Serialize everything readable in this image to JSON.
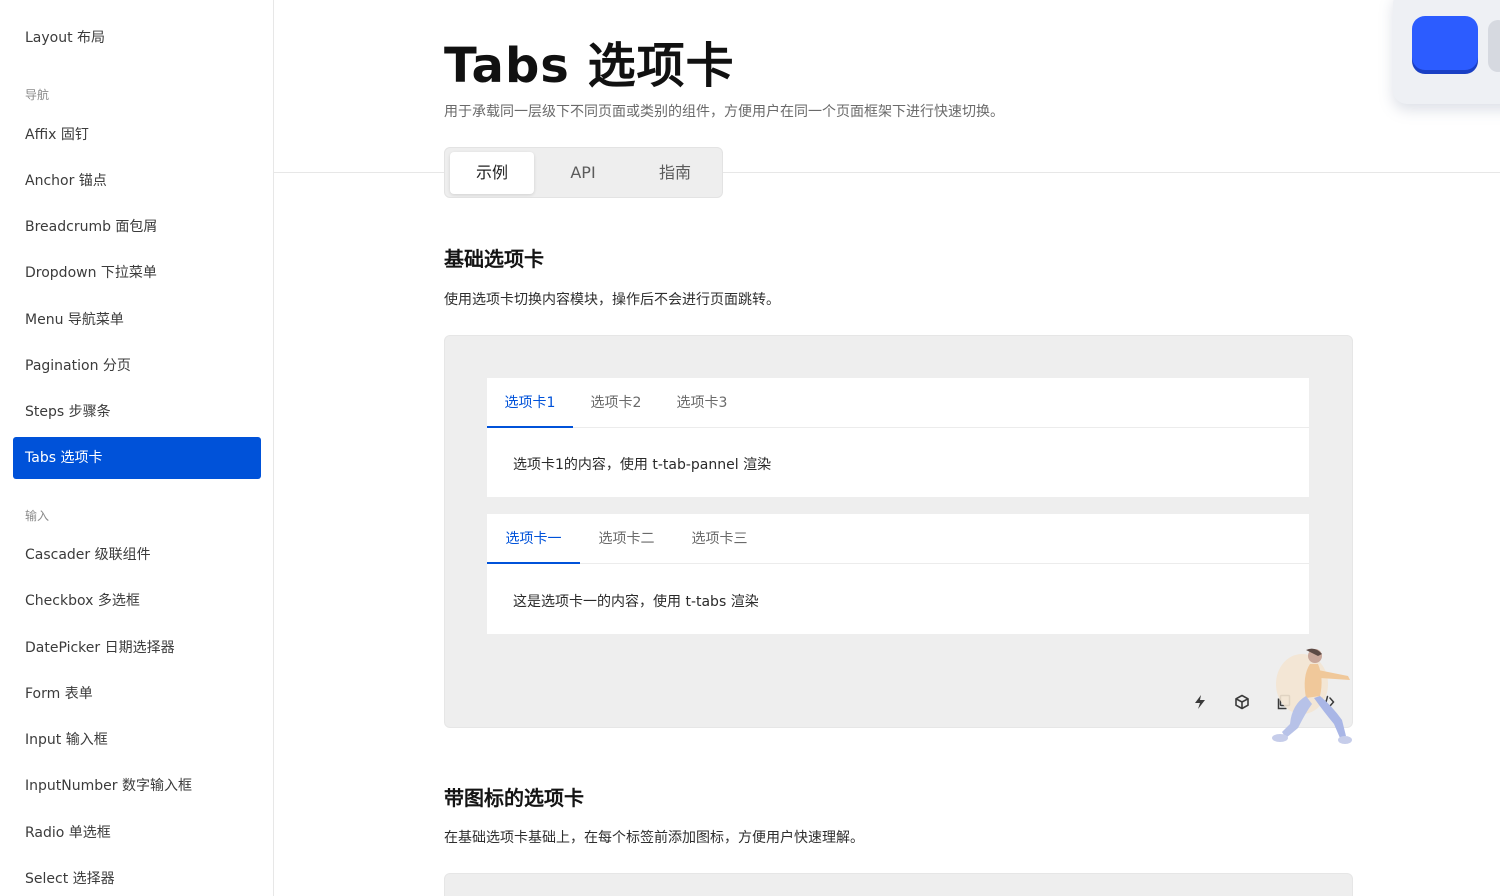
{
  "sidebar": {
    "items_top": [
      {
        "label": "Layout 布局"
      }
    ],
    "group_nav": "导航",
    "items_nav": [
      {
        "label": "Affix 固钉"
      },
      {
        "label": "Anchor 锚点"
      },
      {
        "label": "Breadcrumb 面包屑"
      },
      {
        "label": "Dropdown 下拉菜单"
      },
      {
        "label": "Menu 导航菜单"
      },
      {
        "label": "Pagination 分页"
      },
      {
        "label": "Steps 步骤条"
      },
      {
        "label": "Tabs 选项卡",
        "active": true
      }
    ],
    "group_input": "输入",
    "items_input": [
      {
        "label": "Cascader 级联组件"
      },
      {
        "label": "Checkbox 多选框"
      },
      {
        "label": "DatePicker 日期选择器"
      },
      {
        "label": "Form 表单"
      },
      {
        "label": "Input 输入框"
      },
      {
        "label": "InputNumber 数字输入框"
      },
      {
        "label": "Radio 单选框"
      },
      {
        "label": "Select 选择器"
      }
    ]
  },
  "header": {
    "title": "Tabs 选项卡",
    "description": "用于承载同一层级下不同页面或类别的组件，方便用户在同一个页面框架下进行快速切换。",
    "tabs": [
      {
        "label": "示例",
        "active": true
      },
      {
        "label": "API"
      },
      {
        "label": "指南"
      }
    ]
  },
  "section_basic": {
    "title": "基础选项卡",
    "description": "使用选项卡切换内容模块，操作后不会进行页面跳转。",
    "demo1": {
      "tabs": [
        "选项卡1",
        "选项卡2",
        "选项卡3"
      ],
      "active_index": 0,
      "content": "选项卡1的内容，使用 t-tab-pannel 渲染"
    },
    "demo2": {
      "tabs": [
        "选项卡一",
        "选项卡二",
        "选项卡三"
      ],
      "active_index": 0,
      "content": "这是选项卡一的内容，使用 t-tabs 渲染"
    },
    "toolbar_icons": [
      "lightning-icon",
      "cube-icon",
      "copy-icon",
      "code-icon"
    ]
  },
  "section_icon": {
    "title": "带图标的选项卡",
    "description": "在基础选项卡基础上，在每个标签前添加图标，方便用户快速理解。"
  },
  "colors": {
    "accent": "#0052d9",
    "demo_bg": "#eeeeee",
    "sidebar_text": "#3b3b3b"
  }
}
